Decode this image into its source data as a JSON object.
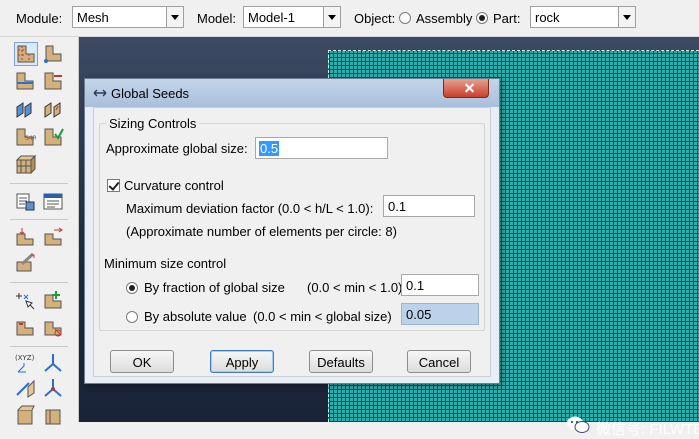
{
  "context_bar": {
    "module_label": "Module:",
    "module_value": "Mesh",
    "model_label": "Model:",
    "model_value": "Model-1",
    "object_label": "Object:",
    "object_assembly": "Assembly",
    "object_part": "Part:",
    "object_selected": "Part",
    "part_value": "rock"
  },
  "toolbox": {
    "tools": [
      "seed-part-icon",
      "seed-edges-icon",
      "seed-by-size-icon",
      "delete-seeds-icon",
      "mesh-controls-icon",
      "element-type-icon",
      "verify-mesh-icon",
      "mesh-part-icon",
      "mesh-region-icon",
      "query-icon",
      "partition-icon",
      "virtual-topology-icon",
      "edit-mesh-icon",
      "assign-orientation-icon",
      "datum-icon",
      "create-set-icon"
    ]
  },
  "dialog": {
    "title": "Global Seeds",
    "sizing_group_label": "Sizing Controls",
    "approx_size_label": "Approximate global size:",
    "approx_size_value": "0.5",
    "curvature_label": "Curvature control",
    "curvature_checked": true,
    "max_dev_label": "Maximum deviation factor (0.0 < h/L < 1.0):",
    "max_dev_value": "0.1",
    "approx_elements_note": "(Approximate number of elements per circle: 8)",
    "min_size_group_label": "Minimum size control",
    "by_fraction_label": "By fraction of global size",
    "by_fraction_range": "(0.0 < min < 1.0)",
    "by_fraction_value": "0.1",
    "by_absolute_label": "By absolute value",
    "by_absolute_range": "(0.0 < min < global size)",
    "by_absolute_value": "0.05",
    "selected_min_option": "By fraction of global size",
    "buttons": {
      "ok": "OK",
      "apply": "Apply",
      "defaults": "Defaults",
      "cancel": "Cancel"
    }
  },
  "viewport": {
    "mesh_color": "#23b2b2",
    "watermark": "微信号: FILWTBY"
  }
}
